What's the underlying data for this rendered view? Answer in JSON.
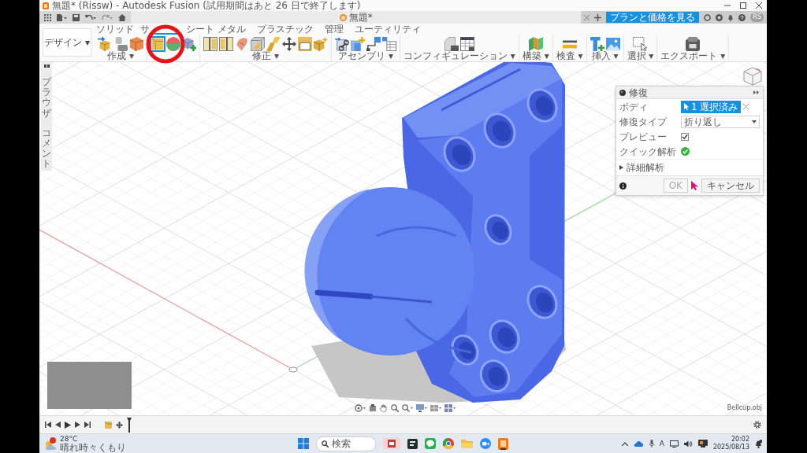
{
  "window": {
    "title": "無題* (Rissw) - Autodesk Fusion (試用期間はあと 26 日で終了します)"
  },
  "quick_access": {
    "document_tab": "無題*",
    "plan_button": "プランと価格を見る",
    "avatar": "RS"
  },
  "toolbar": {
    "workspace": "デザイン ▾",
    "tabs": [
      {
        "label": "ソリッド",
        "selected": false
      },
      {
        "label": "サ",
        "selected": false
      },
      {
        "selected": true
      },
      {
        "label": "シート メタル",
        "selected": false
      },
      {
        "label": "プラスチック",
        "selected": false
      },
      {
        "label": "管理",
        "selected": false
      },
      {
        "label": "ユーティリティ",
        "selected": false
      }
    ],
    "groups": [
      {
        "label": "作成 ▾",
        "tools": [
          {
            "selected": false
          },
          {
            "selected": false
          },
          {
            "selected": false
          }
        ]
      },
      {
        "tools": [
          {
            "selected": true
          },
          {
            "selected": false
          },
          {
            "selected": false
          }
        ]
      },
      {
        "label": "修正 ▾",
        "tools": [
          {
            "selected": false
          },
          {
            "selected": false
          },
          {
            "selected": false
          },
          {
            "selected": false
          },
          {
            "selected": false
          },
          {
            "selected": false
          },
          {
            "selected": false
          },
          {
            "selected": false
          }
        ]
      },
      {
        "label": "アセンブリ ▾",
        "tools": [
          {
            "selected": false
          },
          {
            "selected": false
          },
          {
            "selected": false
          },
          {
            "selected": false
          }
        ]
      },
      {
        "label": "コンフィギュレーション ▾",
        "tools": [
          {
            "selected": false
          },
          {
            "selected": false
          }
        ]
      },
      {
        "label": "構築 ▾",
        "tools": [
          {
            "selected": false
          }
        ]
      },
      {
        "label": "検査 ▾",
        "tools": [
          {
            "selected": false
          }
        ]
      },
      {
        "label": "挿入 ▾",
        "tools": [
          {
            "selected": false
          },
          {
            "selected": false
          }
        ]
      },
      {
        "label": "選択 ▾",
        "tools": [
          {
            "selected": false
          }
        ]
      },
      {
        "label": "エクスポート ▾",
        "tools": [
          {
            "selected": false
          }
        ]
      }
    ]
  },
  "sidebar": {
    "tabs": [
      "ブラウザ",
      "コメント"
    ]
  },
  "repair_panel": {
    "title": "修復",
    "rows": [
      {
        "kind": "selection",
        "label": "ボディ",
        "value": "1 選択済み"
      },
      {
        "kind": "dropdown",
        "label": "修復タイプ",
        "value": "折り返し"
      },
      {
        "kind": "checkbox",
        "label": "プレビュー",
        "checked": true
      },
      {
        "kind": "status",
        "label": "クイック解析",
        "ok": true
      }
    ],
    "section": {
      "label": "詳細解析",
      "expanded": false
    },
    "buttons": [
      {
        "label": "OK",
        "disabled": true
      },
      {
        "label": "キャンセル",
        "disabled": false
      }
    ]
  },
  "viewport": {
    "file_name": "Bellcup.obj"
  },
  "taskbar": {
    "weather": {
      "temperature": "28°C",
      "condition": "晴れ時々くもり"
    },
    "search": {
      "placeholder": "検索"
    },
    "ime": "A",
    "time": "20:02",
    "date": "2025/08/13"
  }
}
